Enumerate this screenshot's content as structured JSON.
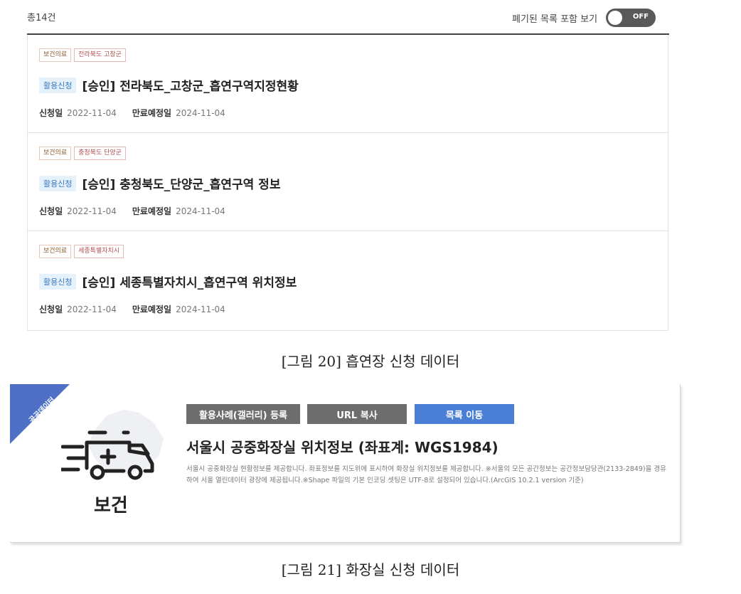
{
  "top_panel": {
    "total": "총14건",
    "toggle_label": "폐기된 목록 포함 보기",
    "toggle_state": "OFF",
    "items": [
      {
        "sector": "보건의료",
        "region": "전라북도 고창군",
        "badge": "활용신청",
        "title": "[승인] 전라북도_고창군_흡연구역지정현황",
        "apply_label": "신청일",
        "apply_date": "2022-11-04",
        "expire_label": "만료예정일",
        "expire_date": "2024-11-04"
      },
      {
        "sector": "보건의료",
        "region": "충청북도 단양군",
        "badge": "활용신청",
        "title": "[승인] 충청북도_단양군_흡연구역 정보",
        "apply_label": "신청일",
        "apply_date": "2022-11-04",
        "expire_label": "만료예정일",
        "expire_date": "2024-11-04"
      },
      {
        "sector": "보건의료",
        "region": "세종특별자치시",
        "badge": "활용신청",
        "title": "[승인] 세종특별자치시_흡연구역 위치정보",
        "apply_label": "신청일",
        "apply_date": "2022-11-04",
        "expire_label": "만료예정일",
        "expire_date": "2024-11-04"
      }
    ]
  },
  "caption1": "[그림 20] 흡연장 신청 데이터",
  "bottom_panel": {
    "ribbon": "공공데이터",
    "category": "보건",
    "category_icon": "ambulance-icon",
    "buttons": {
      "gallery": "활용사례(갤러리) 등록",
      "url_copy": "URL 복사",
      "list_move": "목록 이동"
    },
    "title": "서울시 공중화장실 위치정보 (좌표계: WGS1984)",
    "description": "서울시 공중화장실 현황정보를 제공합니다. 좌표정보를 지도위에 표시하여 화장실 위치정보를 제공합니다. ※서울의 모든 공간정보는 공간정보담당관(2133-2849)을 경유하여 서울 열린데이터 광장에 제공됩니다.※Shape 파일의 기본 인코딩 셋팅은 UTF-8로 설정되어 있습니다.(ArcGIS 10.2.1 version 기준)"
  },
  "caption2": "[그림 21] 화장실 신청 데이터",
  "colors": {
    "ribbon": "#4d6fc5",
    "blue_button": "#4b7fd6",
    "gray_button": "#6d6d6d",
    "badge_bg": "#e5f1fb",
    "badge_text": "#3a7abf",
    "toggle_bg": "#595959"
  }
}
